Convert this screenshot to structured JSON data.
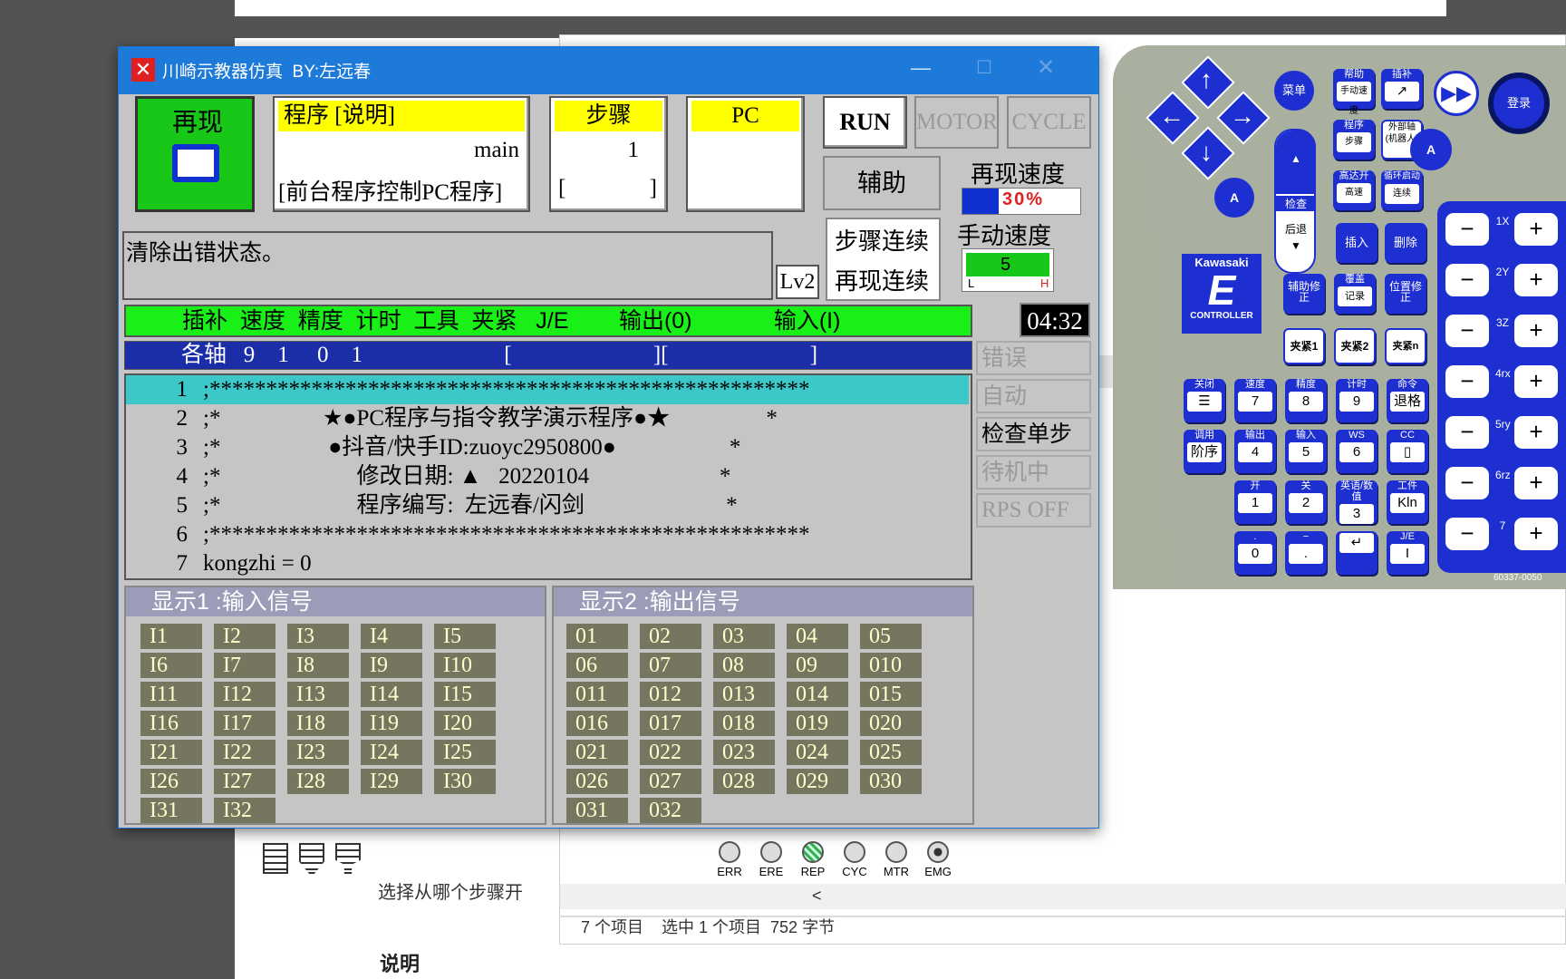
{
  "window": {
    "title": "川崎示教器仿真  BY:左远春"
  },
  "top_panel": {
    "mode": "再现",
    "program": {
      "header": "程序  [说明]",
      "name": "main",
      "comment": "[前台程序控制PC程序]"
    },
    "step": {
      "header": "步骤",
      "value": "1",
      "bracket_left": "[",
      "bracket_right": "]"
    },
    "pc": {
      "header": "PC"
    },
    "run": "RUN",
    "motor": "MOTOR",
    "cycle": "CYCLE",
    "aux": "辅助",
    "replay_speed_label": "再现速度",
    "replay_speed_value": "30%",
    "manual_speed_label": "手动速度",
    "manual_speed_value": "5",
    "manual_speed_L": "L",
    "manual_speed_H": "H",
    "step_continuous": "步骤连续",
    "replay_continuous": "再现连续",
    "message": "清除出错状态。",
    "level": "Lv2",
    "clock": "04:32"
  },
  "status_header": "插补  速度  精度  计时  工具  夹紧   J/E        输出(0)             输入(I)",
  "axis_bar": "各轴   9    1     0    1                         [                         ][                         ]",
  "status_buttons": [
    {
      "label": "错误",
      "enabled": false
    },
    {
      "label": "自动",
      "enabled": false
    },
    {
      "label": "检查单步",
      "enabled": true
    },
    {
      "label": "待机中",
      "enabled": false
    },
    {
      "label": "RPS OFF",
      "enabled": false
    }
  ],
  "program_lines": [
    {
      "n": "1",
      "text": ";*****************************************************"
    },
    {
      "n": "2",
      "text": ";*                  ★●PC程序与指令教学演示程序●★                 *"
    },
    {
      "n": "3",
      "text": ";*                   ●抖音/快手ID:zuoyc2950800●                    *"
    },
    {
      "n": "4",
      "text": ";*                        修改日期: ▲   20220104                       *"
    },
    {
      "n": "5",
      "text": ";*                        程序编写:  左远春/闪剑                         *"
    },
    {
      "n": "6",
      "text": ";*****************************************************"
    },
    {
      "n": "7",
      "text": "kongzhi = 0"
    }
  ],
  "display1": {
    "title": "显示1 :输入信号",
    "signals": [
      "I1",
      "I2",
      "I3",
      "I4",
      "I5",
      "I6",
      "I7",
      "I8",
      "I9",
      "I10",
      "I11",
      "I12",
      "I13",
      "I14",
      "I15",
      "I16",
      "I17",
      "I18",
      "I19",
      "I20",
      "I21",
      "I22",
      "I23",
      "I24",
      "I25",
      "I26",
      "I27",
      "I28",
      "I29",
      "I30",
      "I31",
      "I32"
    ]
  },
  "display2": {
    "title": "显示2 :输出信号",
    "signals": [
      "01",
      "02",
      "03",
      "04",
      "05",
      "06",
      "07",
      "08",
      "09",
      "010",
      "011",
      "012",
      "013",
      "014",
      "015",
      "016",
      "017",
      "018",
      "019",
      "020",
      "021",
      "022",
      "023",
      "024",
      "025",
      "026",
      "027",
      "028",
      "029",
      "030",
      "031",
      "032"
    ]
  },
  "lamps": [
    "ERR",
    "ERE",
    "REP",
    "CYC",
    "MTR",
    "EMG"
  ],
  "background": {
    "explorer_status": "7 个项目    选中 1 个项目  752 字节",
    "doc_text1": "选择从哪个步骤开",
    "doc_text2": "说明",
    "scroll_left": "<"
  },
  "pendant": {
    "brand": "Kawasaki",
    "logo_letter": "E",
    "controller": "CONTROLLER",
    "model": "60337-0050",
    "menu": "菜单",
    "login": "登录",
    "A": "A",
    "forward": "前进",
    "check": "检查",
    "back": "后退",
    "keys_top": [
      {
        "top": "帮助",
        "bottom": "手动速度"
      },
      {
        "top": "插补",
        "bottom": "↗"
      },
      {
        "top": "程序",
        "bottom": "步骤"
      },
      {
        "top": "",
        "bottom": "外部轴 (机器人)"
      },
      {
        "top": "高达开",
        "bottom": "高速"
      },
      {
        "top": "循环启动",
        "bottom": "连续"
      }
    ],
    "insert": "插入",
    "delete": "删除",
    "assist_correct": "辅助修正",
    "overwrite": "覆盖",
    "record": "记录",
    "pos_correct": "位置修正",
    "clamps": [
      "夹紧1",
      "夹紧2",
      "夹紧n"
    ],
    "numpad": [
      {
        "top": "关闭",
        "main": "☰"
      },
      {
        "top": "速度",
        "main": "7"
      },
      {
        "top": "精度",
        "main": "8"
      },
      {
        "top": "计时",
        "main": "9"
      },
      {
        "top": "命令",
        "main": "退格"
      },
      {
        "top": "调用",
        "main": "阶序"
      },
      {
        "top": "输出",
        "main": "4"
      },
      {
        "top": "输入",
        "main": "5"
      },
      {
        "top": "WS",
        "main": "6"
      },
      {
        "top": "CC",
        "main": "▯"
      },
      {
        "top": "开",
        "main": "1"
      },
      {
        "top": "关",
        "main": "2"
      },
      {
        "top": "英语/数值",
        "main": "3"
      },
      {
        "top": "工件",
        "main": "Kln"
      },
      {
        "top": ".",
        "main": "0"
      },
      {
        "top": "−",
        "main": "."
      },
      {
        "top": "",
        "main": "↵"
      },
      {
        "top": "J/E",
        "main": "I"
      }
    ],
    "axes": [
      "1X",
      "2Y",
      "3Z",
      "4rx",
      "5ry",
      "6rz",
      "7"
    ],
    "minus": "−",
    "plus": "+"
  }
}
